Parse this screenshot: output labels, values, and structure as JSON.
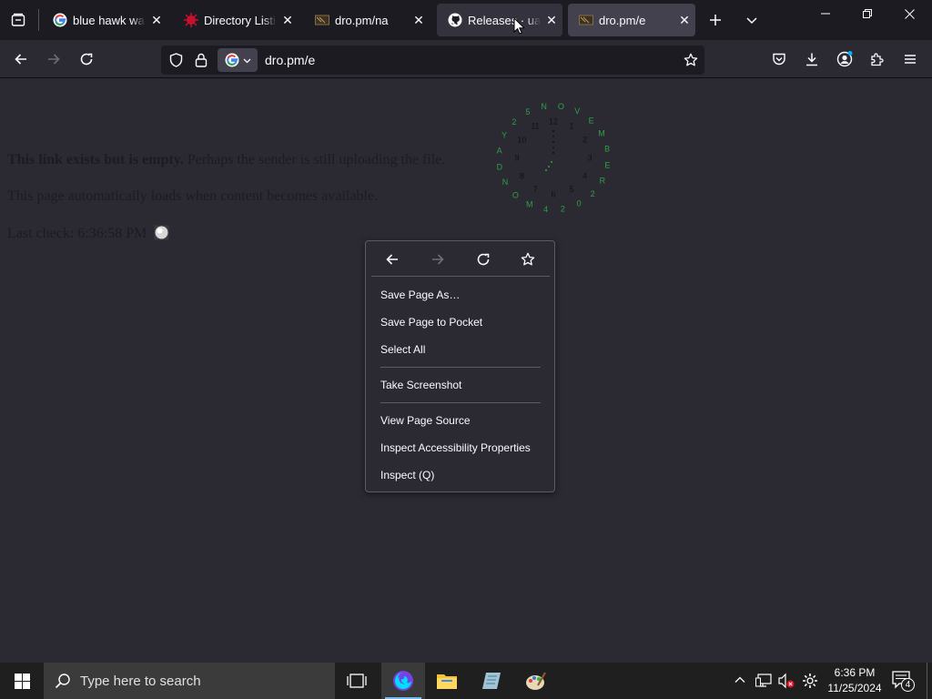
{
  "browser": {
    "tabs": [
      {
        "title": "blue hawk wallp",
        "favicon": "google-icon"
      },
      {
        "title": "Directory Listing",
        "favicon": "red-splat-icon"
      },
      {
        "title": "dro.pm/na",
        "favicon": "dro-pm-icon"
      },
      {
        "title": "Releases · ualin",
        "favicon": "github-icon"
      },
      {
        "title": "dro.pm/e",
        "favicon": "dro-pm-icon"
      }
    ],
    "url": "dro.pm/e"
  },
  "page": {
    "line1_bold": "This link exists but is empty.",
    "line1_rest": " Perhaps the sender is still uploading the file.",
    "line2": "This page automatically loads when content becomes available.",
    "last_check_label": "Last check: ",
    "last_check_time": "6:36:58 PM",
    "clock": {
      "numbers": [
        "12",
        "1",
        "2",
        "3",
        "4",
        "5",
        "6",
        "7",
        "8",
        "9",
        "10",
        "11"
      ],
      "date_letters": [
        "N",
        "O",
        "V",
        "E",
        "M",
        "B",
        "E",
        "R",
        "2",
        "0",
        "2",
        "4",
        "M",
        "O",
        "N",
        "D",
        "A",
        "Y",
        "2",
        "5"
      ],
      "color_numbers": "#111111",
      "color_date": "#2ea043"
    }
  },
  "context_menu": {
    "items": [
      "Save Page As…",
      "Save Page to Pocket",
      "Select All",
      "Take Screenshot",
      "View Page Source",
      "Inspect Accessibility Properties",
      "Inspect (Q)"
    ]
  },
  "taskbar": {
    "search_placeholder": "Type here to search",
    "time": "6:36 PM",
    "date": "11/25/2024",
    "notification_count": "4"
  },
  "colors": {
    "chrome_dark": "#1c1b22",
    "chrome": "#2b2a33",
    "active_tab": "#42414d",
    "text": "#fbfbfe",
    "taskbar": "#1f1f1f"
  }
}
